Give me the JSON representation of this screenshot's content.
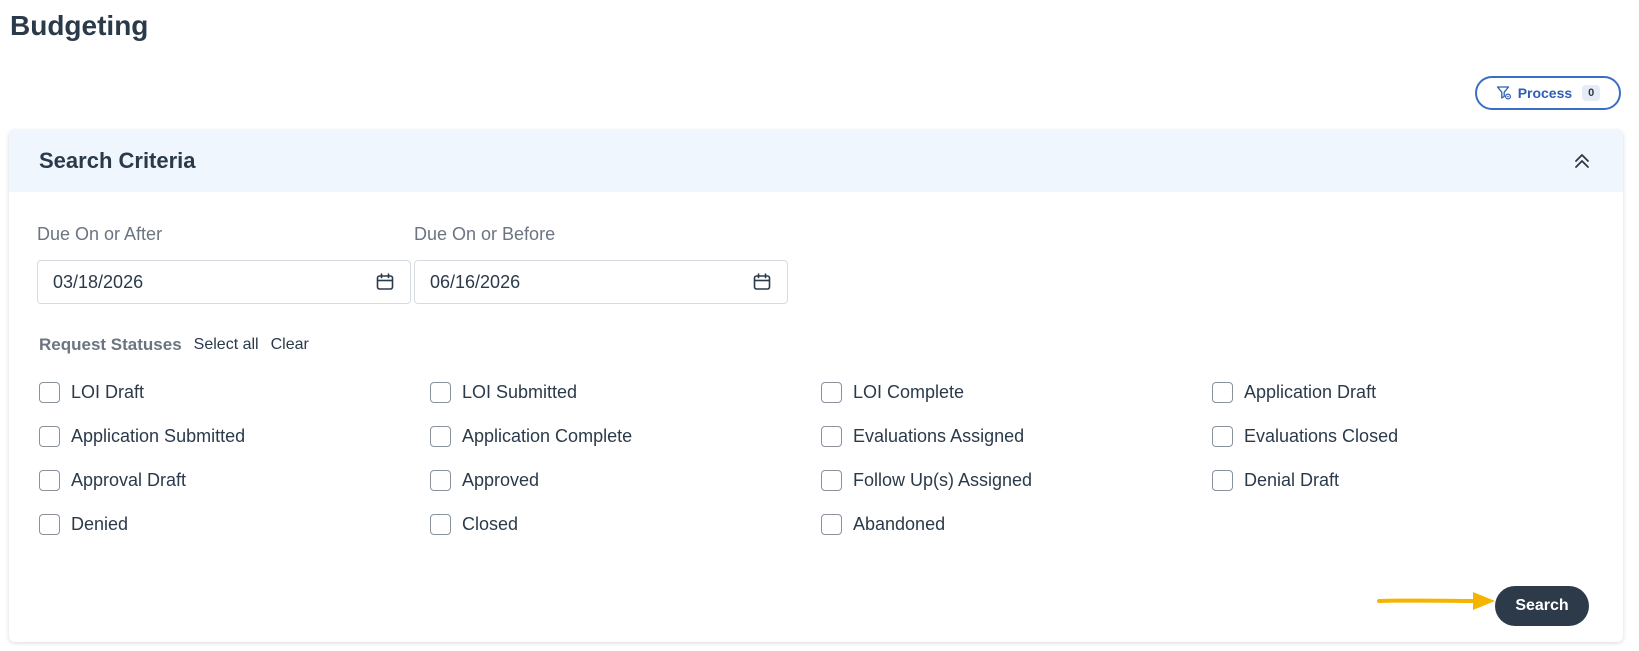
{
  "page": {
    "title": "Budgeting"
  },
  "process": {
    "label": "Process",
    "count": "0"
  },
  "search_criteria": {
    "title": "Search Criteria",
    "due_after": {
      "label": "Due On or After",
      "value": "03/18/2026"
    },
    "due_before": {
      "label": "Due On or Before",
      "value": "06/16/2026"
    },
    "statuses": {
      "label": "Request Statuses",
      "select_all": "Select all",
      "clear": "Clear",
      "options": [
        "LOI Draft",
        "LOI Submitted",
        "LOI Complete",
        "Application Draft",
        "Application Submitted",
        "Application Complete",
        "Evaluations Assigned",
        "Evaluations Closed",
        "Approval Draft",
        "Approved",
        "Follow Up(s) Assigned",
        "Denial Draft",
        "Denied",
        "Closed",
        "Abandoned"
      ]
    },
    "search_button": "Search"
  },
  "colors": {
    "header_bg": "#eff6fd",
    "accent": "#3a6fc4",
    "button_dark": "#2d3a4a",
    "annotation_arrow": "#f5b400"
  },
  "icons": {
    "process": "filter-gear-icon",
    "collapse": "chevron-double-up-icon",
    "calendar": "calendar-icon"
  }
}
